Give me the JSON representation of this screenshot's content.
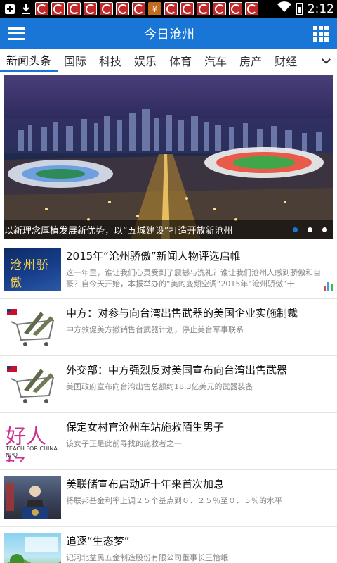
{
  "statusbar": {
    "time": "2:12",
    "battery_level": 0.55,
    "notification_icons": [
      "add-box-icon",
      "download-icon",
      "app-icon",
      "app-icon",
      "app-icon",
      "app-icon",
      "app-icon",
      "app-icon",
      "app-icon",
      "orange-app-icon",
      "app-icon",
      "app-icon",
      "app-icon",
      "app-icon",
      "app-icon",
      "app-icon"
    ]
  },
  "appbar": {
    "title": "今日沧州",
    "color": "#1976d6"
  },
  "tabs": {
    "items": [
      "新闻头条",
      "国际",
      "科技",
      "娱乐",
      "体育",
      "汽车",
      "房产",
      "财经"
    ],
    "active_index": 0
  },
  "banner": {
    "caption": "以新理念厚植发展新优势，以“五城建设”打造开放新沧州",
    "slide_count": 3,
    "active_slide": 0
  },
  "news": [
    {
      "title": "2015年“沧州骄傲”新闻人物评选启帷",
      "summary": "这一年里，谁让我们心灵受到了震撼与洗礼？谁让我们沧州人感到骄傲和自豪？自今天开始，本报举办的“美的变频空调“2015年“沧州骄傲“十",
      "thumb_text": "沧州骄傲"
    },
    {
      "title": "中方：对参与向台湾出售武器的美国企业实施制裁",
      "summary": "中方敦促美方撤销售台武器计划，停止美台军事联系"
    },
    {
      "title": "外交部：中方强烈反对美国宣布向台湾出售武器",
      "summary": "美国政府宣布向台湾出售总额约18.3亿美元的武器装备"
    },
    {
      "title": "保定女村官沧州车站施救陌生男子",
      "summary": "该女子正是此前寻找的施救者之一",
      "thumb_text": "好人好",
      "thumb_subtext": "TEACH FOR CHINA NPO"
    },
    {
      "title": "美联储宣布启动近十年来首次加息",
      "summary": "将联邦基金利率上调２５个基点到０．２５％至０．５％的水平"
    },
    {
      "title": "追逐“生态梦”",
      "summary": "记河北益民五金制造股份有限公司董事长王恰岷"
    }
  ]
}
